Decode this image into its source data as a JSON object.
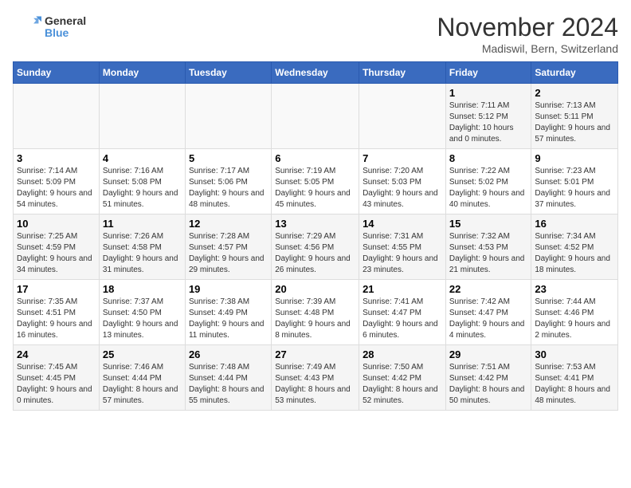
{
  "logo": {
    "general": "General",
    "blue": "Blue"
  },
  "title": {
    "month": "November 2024",
    "location": "Madiswil, Bern, Switzerland"
  },
  "days_of_week": [
    "Sunday",
    "Monday",
    "Tuesday",
    "Wednesday",
    "Thursday",
    "Friday",
    "Saturday"
  ],
  "weeks": [
    [
      {
        "day": "",
        "info": ""
      },
      {
        "day": "",
        "info": ""
      },
      {
        "day": "",
        "info": ""
      },
      {
        "day": "",
        "info": ""
      },
      {
        "day": "",
        "info": ""
      },
      {
        "day": "1",
        "info": "Sunrise: 7:11 AM\nSunset: 5:12 PM\nDaylight: 10 hours and 0 minutes."
      },
      {
        "day": "2",
        "info": "Sunrise: 7:13 AM\nSunset: 5:11 PM\nDaylight: 9 hours and 57 minutes."
      }
    ],
    [
      {
        "day": "3",
        "info": "Sunrise: 7:14 AM\nSunset: 5:09 PM\nDaylight: 9 hours and 54 minutes."
      },
      {
        "day": "4",
        "info": "Sunrise: 7:16 AM\nSunset: 5:08 PM\nDaylight: 9 hours and 51 minutes."
      },
      {
        "day": "5",
        "info": "Sunrise: 7:17 AM\nSunset: 5:06 PM\nDaylight: 9 hours and 48 minutes."
      },
      {
        "day": "6",
        "info": "Sunrise: 7:19 AM\nSunset: 5:05 PM\nDaylight: 9 hours and 45 minutes."
      },
      {
        "day": "7",
        "info": "Sunrise: 7:20 AM\nSunset: 5:03 PM\nDaylight: 9 hours and 43 minutes."
      },
      {
        "day": "8",
        "info": "Sunrise: 7:22 AM\nSunset: 5:02 PM\nDaylight: 9 hours and 40 minutes."
      },
      {
        "day": "9",
        "info": "Sunrise: 7:23 AM\nSunset: 5:01 PM\nDaylight: 9 hours and 37 minutes."
      }
    ],
    [
      {
        "day": "10",
        "info": "Sunrise: 7:25 AM\nSunset: 4:59 PM\nDaylight: 9 hours and 34 minutes."
      },
      {
        "day": "11",
        "info": "Sunrise: 7:26 AM\nSunset: 4:58 PM\nDaylight: 9 hours and 31 minutes."
      },
      {
        "day": "12",
        "info": "Sunrise: 7:28 AM\nSunset: 4:57 PM\nDaylight: 9 hours and 29 minutes."
      },
      {
        "day": "13",
        "info": "Sunrise: 7:29 AM\nSunset: 4:56 PM\nDaylight: 9 hours and 26 minutes."
      },
      {
        "day": "14",
        "info": "Sunrise: 7:31 AM\nSunset: 4:55 PM\nDaylight: 9 hours and 23 minutes."
      },
      {
        "day": "15",
        "info": "Sunrise: 7:32 AM\nSunset: 4:53 PM\nDaylight: 9 hours and 21 minutes."
      },
      {
        "day": "16",
        "info": "Sunrise: 7:34 AM\nSunset: 4:52 PM\nDaylight: 9 hours and 18 minutes."
      }
    ],
    [
      {
        "day": "17",
        "info": "Sunrise: 7:35 AM\nSunset: 4:51 PM\nDaylight: 9 hours and 16 minutes."
      },
      {
        "day": "18",
        "info": "Sunrise: 7:37 AM\nSunset: 4:50 PM\nDaylight: 9 hours and 13 minutes."
      },
      {
        "day": "19",
        "info": "Sunrise: 7:38 AM\nSunset: 4:49 PM\nDaylight: 9 hours and 11 minutes."
      },
      {
        "day": "20",
        "info": "Sunrise: 7:39 AM\nSunset: 4:48 PM\nDaylight: 9 hours and 8 minutes."
      },
      {
        "day": "21",
        "info": "Sunrise: 7:41 AM\nSunset: 4:47 PM\nDaylight: 9 hours and 6 minutes."
      },
      {
        "day": "22",
        "info": "Sunrise: 7:42 AM\nSunset: 4:47 PM\nDaylight: 9 hours and 4 minutes."
      },
      {
        "day": "23",
        "info": "Sunrise: 7:44 AM\nSunset: 4:46 PM\nDaylight: 9 hours and 2 minutes."
      }
    ],
    [
      {
        "day": "24",
        "info": "Sunrise: 7:45 AM\nSunset: 4:45 PM\nDaylight: 9 hours and 0 minutes."
      },
      {
        "day": "25",
        "info": "Sunrise: 7:46 AM\nSunset: 4:44 PM\nDaylight: 8 hours and 57 minutes."
      },
      {
        "day": "26",
        "info": "Sunrise: 7:48 AM\nSunset: 4:44 PM\nDaylight: 8 hours and 55 minutes."
      },
      {
        "day": "27",
        "info": "Sunrise: 7:49 AM\nSunset: 4:43 PM\nDaylight: 8 hours and 53 minutes."
      },
      {
        "day": "28",
        "info": "Sunrise: 7:50 AM\nSunset: 4:42 PM\nDaylight: 8 hours and 52 minutes."
      },
      {
        "day": "29",
        "info": "Sunrise: 7:51 AM\nSunset: 4:42 PM\nDaylight: 8 hours and 50 minutes."
      },
      {
        "day": "30",
        "info": "Sunrise: 7:53 AM\nSunset: 4:41 PM\nDaylight: 8 hours and 48 minutes."
      }
    ]
  ]
}
